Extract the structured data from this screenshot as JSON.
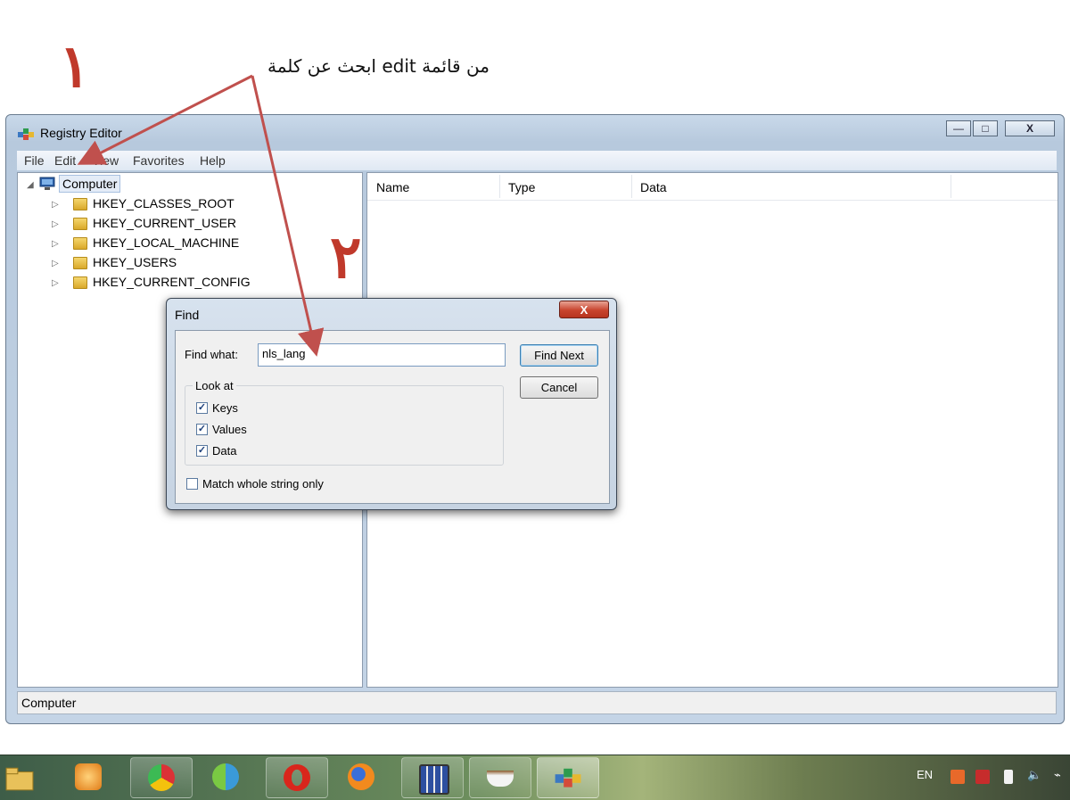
{
  "annotations": {
    "step1": "١",
    "step2": "٢",
    "instruction_text": "من قائمة edit ابحث عن كلمة",
    "arrow_color": "#c0504d"
  },
  "window": {
    "title": "Registry Editor",
    "app_icon": "registry-icon",
    "controls": {
      "minimize": "—",
      "maximize": "□",
      "close": "X"
    },
    "menu": [
      "File",
      "Edit",
      "View",
      "Favorites",
      "Help"
    ],
    "tree": {
      "root": "Computer",
      "items": [
        "HKEY_CLASSES_ROOT",
        "HKEY_CURRENT_USER",
        "HKEY_LOCAL_MACHINE",
        "HKEY_USERS",
        "HKEY_CURRENT_CONFIG"
      ]
    },
    "list_columns": [
      "Name",
      "Type",
      "Data"
    ],
    "status": "Computer"
  },
  "find_dialog": {
    "title": "Find",
    "close_label": "X",
    "find_what_label": "Find what:",
    "find_what_value": "nls_lang",
    "find_next_label": "Find Next",
    "cancel_label": "Cancel",
    "look_at_label": "Look at",
    "keys_label": "Keys",
    "keys_checked": true,
    "values_label": "Values",
    "values_checked": true,
    "data_label": "Data",
    "data_checked": true,
    "match_label": "Match whole string only",
    "match_checked": false
  },
  "taskbar": {
    "apps": [
      "explorer-icon",
      "media-player-icon",
      "chrome-icon",
      "browser-icon",
      "opera-icon",
      "firefox-icon",
      "calculator-icon",
      "coffee-icon",
      "registry-icon"
    ],
    "language": "EN"
  }
}
